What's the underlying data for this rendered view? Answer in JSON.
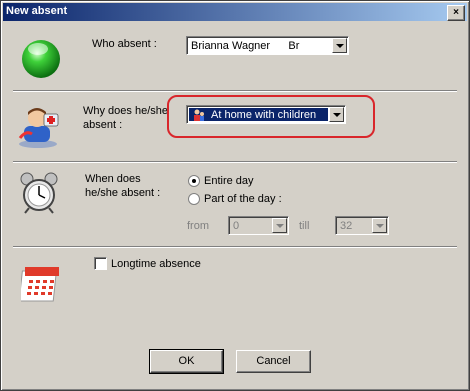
{
  "window": {
    "title": "New absent",
    "close_label": "×"
  },
  "who": {
    "label": "Who absent :",
    "value": "Brianna Wagner      Br"
  },
  "why": {
    "label_line1": "Why does he/she",
    "label_line2": "absent :",
    "value": "At home with children"
  },
  "when": {
    "label_line1": "When does",
    "label_line2": "he/she absent :",
    "entire_day": "Entire day",
    "part_of_day": "Part of the day :",
    "from_label": "from",
    "from_value": "0",
    "till_label": "till",
    "till_value": "32",
    "selected": "entire_day"
  },
  "longtime": {
    "label": "Longtime absence",
    "checked": false
  },
  "buttons": {
    "ok": "OK",
    "cancel": "Cancel"
  },
  "colors": {
    "highlight": "#d9262b",
    "title_start": "#0a246a",
    "title_end": "#a6caf0",
    "selection": "#0a246a"
  }
}
